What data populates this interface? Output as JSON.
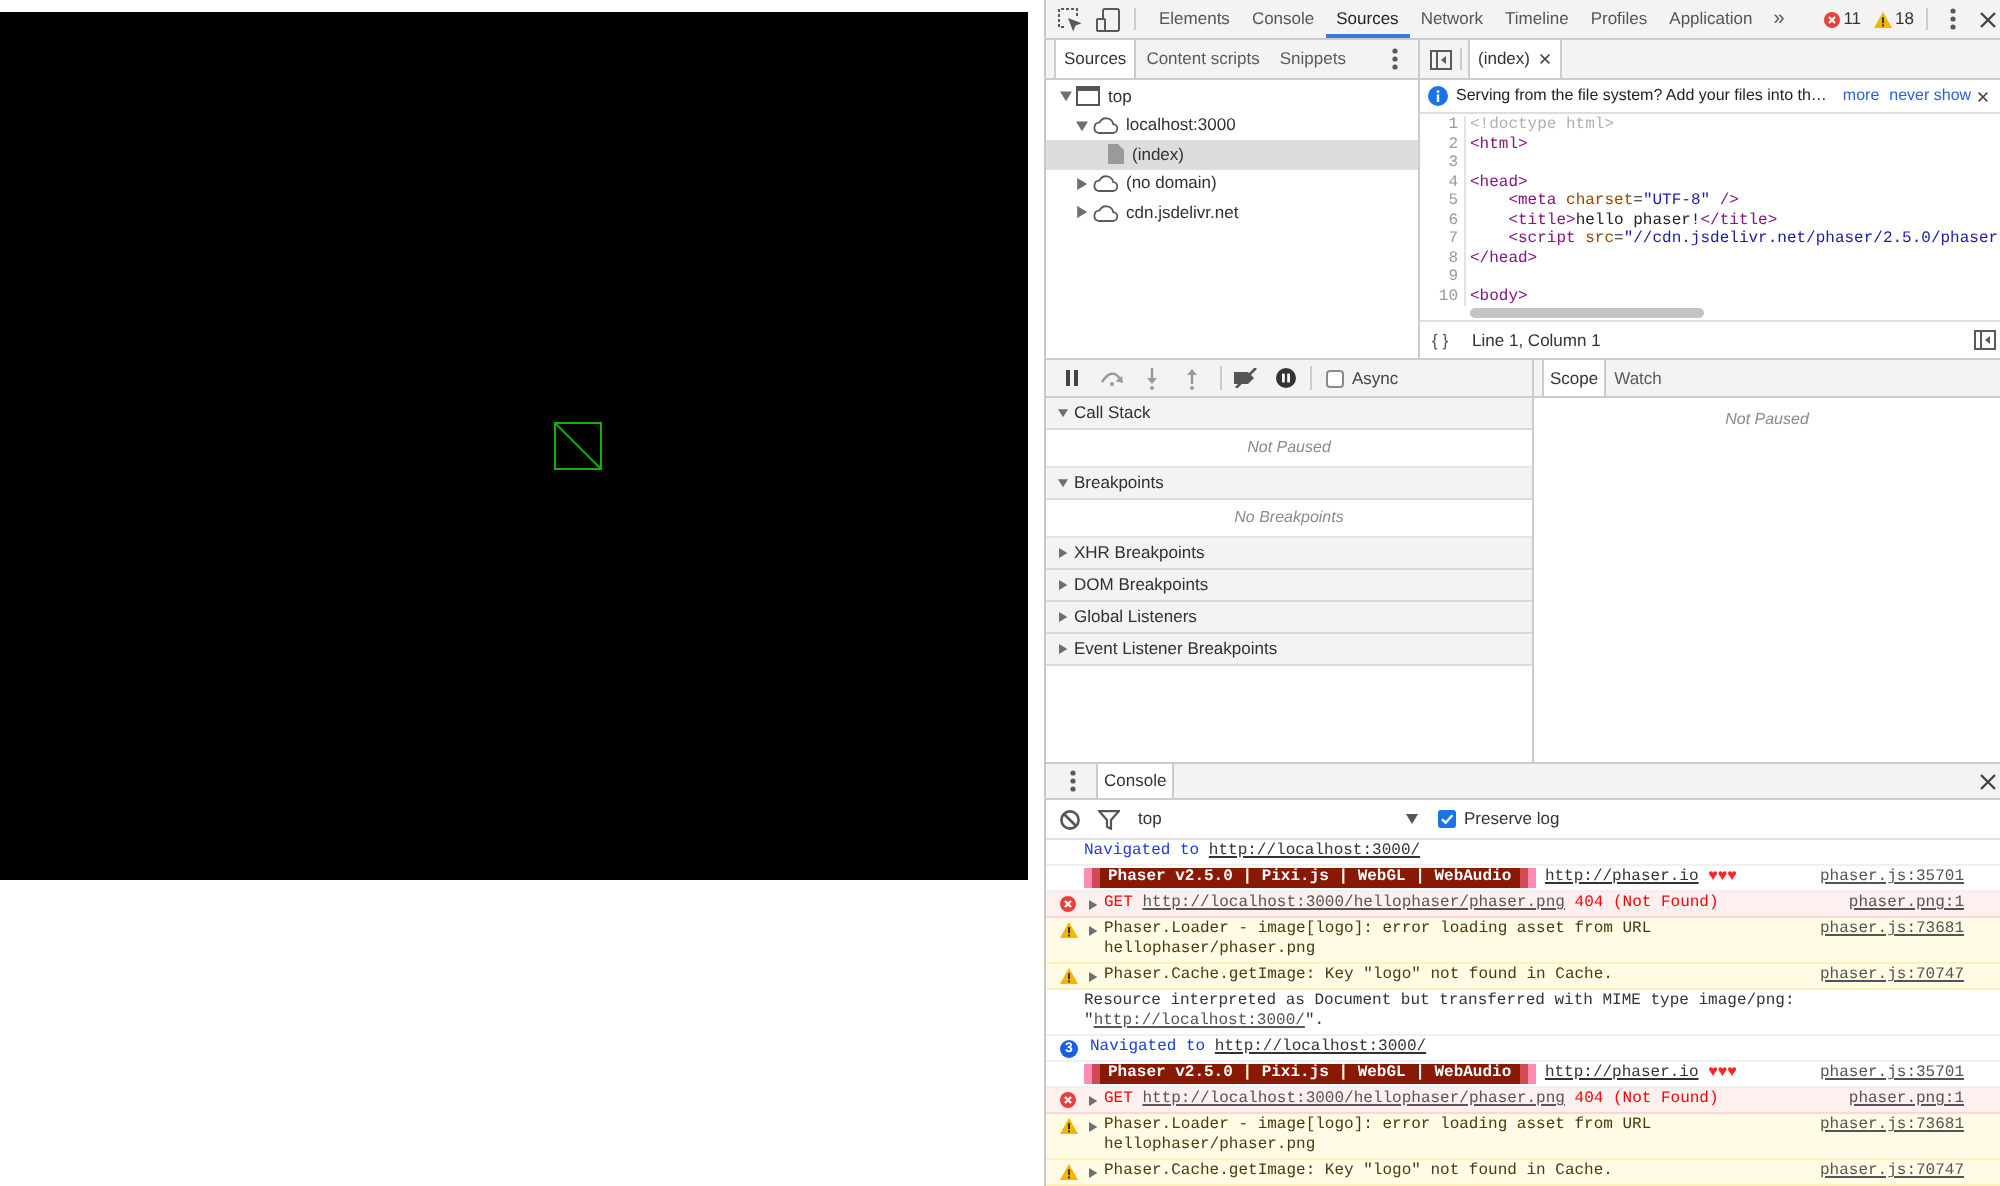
{
  "toolbar": {
    "tabs": [
      {
        "label": "Elements",
        "selected": false
      },
      {
        "label": "Console",
        "selected": false
      },
      {
        "label": "Sources",
        "selected": true
      },
      {
        "label": "Network",
        "selected": false
      },
      {
        "label": "Timeline",
        "selected": false
      },
      {
        "label": "Profiles",
        "selected": false
      },
      {
        "label": "Application",
        "selected": false
      }
    ],
    "overflow": "»",
    "error_count": "11",
    "warning_count": "18"
  },
  "navigator": {
    "tabs": [
      {
        "label": "Sources",
        "selected": true
      },
      {
        "label": "Content scripts",
        "selected": false
      },
      {
        "label": "Snippets",
        "selected": false
      }
    ],
    "tree": [
      {
        "label": "top",
        "kind": "frame",
        "expanded": true,
        "selected": false,
        "children": [
          {
            "label": "localhost:3000",
            "kind": "domain",
            "expanded": true,
            "selected": false,
            "children": [
              {
                "label": "(index)",
                "kind": "file",
                "selected": true
              }
            ]
          },
          {
            "label": "(no domain)",
            "kind": "domain",
            "expanded": false,
            "selected": false
          },
          {
            "label": "cdn.jsdelivr.net",
            "kind": "domain",
            "expanded": false,
            "selected": false
          }
        ]
      }
    ]
  },
  "editor": {
    "tabs": [
      {
        "label": "(index)",
        "selected": true
      }
    ],
    "infobar": {
      "message": "Serving from the file system? Add your files into th…",
      "links": [
        "more",
        "never show"
      ]
    },
    "lines": [
      {
        "number": "1",
        "tokens": [
          {
            "kind": "doctype",
            "text": "<!doctype html>"
          }
        ]
      },
      {
        "number": "2",
        "tokens": [
          {
            "kind": "tag",
            "text": "<html>"
          }
        ]
      },
      {
        "number": "3"
      },
      {
        "number": "4",
        "tokens": [
          {
            "kind": "tag",
            "text": "<head>"
          }
        ]
      },
      {
        "number": "5",
        "tokens": [
          {
            "kind": "tag",
            "text": "    <meta"
          },
          {
            "kind": "attr",
            "text": " charset"
          },
          {
            "kind": "text",
            "text": "="
          },
          {
            "kind": "value",
            "text": "\"UTF-8\""
          },
          {
            "kind": "tag",
            "text": " />"
          }
        ]
      },
      {
        "number": "6",
        "tokens": [
          {
            "kind": "tag",
            "text": "    <title>"
          },
          {
            "kind": "text",
            "text": "hello phaser!"
          },
          {
            "kind": "tag",
            "text": "</title>"
          }
        ]
      },
      {
        "number": "7",
        "tokens": [
          {
            "kind": "tag",
            "text": "    <script"
          },
          {
            "kind": "attr",
            "text": " src"
          },
          {
            "kind": "text",
            "text": "="
          },
          {
            "kind": "value",
            "text": "\"//cdn.jsdelivr.net/phaser/2.5.0/phaser"
          }
        ]
      },
      {
        "number": "8",
        "tokens": [
          {
            "kind": "tag",
            "text": "</head>"
          }
        ]
      },
      {
        "number": "9"
      },
      {
        "number": "10",
        "tokens": [
          {
            "kind": "tag",
            "text": "<body>"
          }
        ]
      }
    ],
    "pretty_print": "{ }",
    "cursor": "Line 1, Column 1"
  },
  "debugger": {
    "async": {
      "label": "Async",
      "checked": false
    },
    "panes": [
      {
        "title": "Call Stack",
        "expanded": true,
        "message": "Not Paused"
      },
      {
        "title": "Breakpoints",
        "expanded": true,
        "message": "No Breakpoints"
      },
      {
        "title": "XHR Breakpoints",
        "expanded": false
      },
      {
        "title": "DOM Breakpoints",
        "expanded": false
      },
      {
        "title": "Global Listeners",
        "expanded": false
      },
      {
        "title": "Event Listener Breakpoints",
        "expanded": false
      }
    ]
  },
  "scope": {
    "tabs": [
      {
        "label": "Scope",
        "selected": true
      },
      {
        "label": "Watch",
        "selected": false
      }
    ],
    "message": "Not Paused"
  },
  "console": {
    "tabs": [
      {
        "label": "Console",
        "selected": true
      }
    ],
    "context": "top",
    "preserve_log": {
      "label": "Preserve log",
      "checked": true
    },
    "messages": [
      {
        "kind": "navigation",
        "prefix": "Navigated to",
        "url": "http://localhost:3000/"
      },
      {
        "kind": "banner",
        "banner": "Phaser v2.5.0 | Pixi.js | WebGL | WebAudio",
        "url": "http://phaser.io",
        "hearts": "♥♥♥",
        "source": "phaser.js:35701"
      },
      {
        "kind": "error",
        "expanded": false,
        "prefix": "GET",
        "url": "http://localhost:3000/hellophaser/phaser.png",
        "suffix": "404 (Not Found)",
        "source": "phaser.png:1"
      },
      {
        "kind": "warning",
        "expanded": false,
        "text": "Phaser.Loader - image[logo]: error loading asset from URL hellophaser/phaser.png",
        "source": "phaser.js:73681"
      },
      {
        "kind": "warning",
        "expanded": false,
        "text": "Phaser.Cache.getImage: Key \"logo\" not found in Cache.",
        "source": "phaser.js:70747"
      },
      {
        "kind": "plain",
        "prefix": "Resource interpreted as Document but transferred with MIME type image/png: \"",
        "url": "http://localhost:3000/",
        "suffix": "\"."
      },
      {
        "kind": "navigation",
        "count": "3",
        "prefix": "Navigated to",
        "url": "http://localhost:3000/"
      },
      {
        "kind": "banner",
        "banner": "Phaser v2.5.0 | Pixi.js | WebGL | WebAudio",
        "url": "http://phaser.io",
        "hearts": "♥♥♥",
        "source": "phaser.js:35701"
      },
      {
        "kind": "error",
        "expanded": false,
        "prefix": "GET",
        "url": "http://localhost:3000/hellophaser/phaser.png",
        "suffix": "404 (Not Found)",
        "source": "phaser.png:1"
      },
      {
        "kind": "warning",
        "expanded": false,
        "text": "Phaser.Loader - image[logo]: error loading asset from URL hellophaser/phaser.png",
        "source": "phaser.js:73681"
      },
      {
        "kind": "warning",
        "expanded": false,
        "text": "Phaser.Cache.getImage: Key \"logo\" not found in Cache.",
        "source": "phaser.js:70747"
      }
    ]
  }
}
